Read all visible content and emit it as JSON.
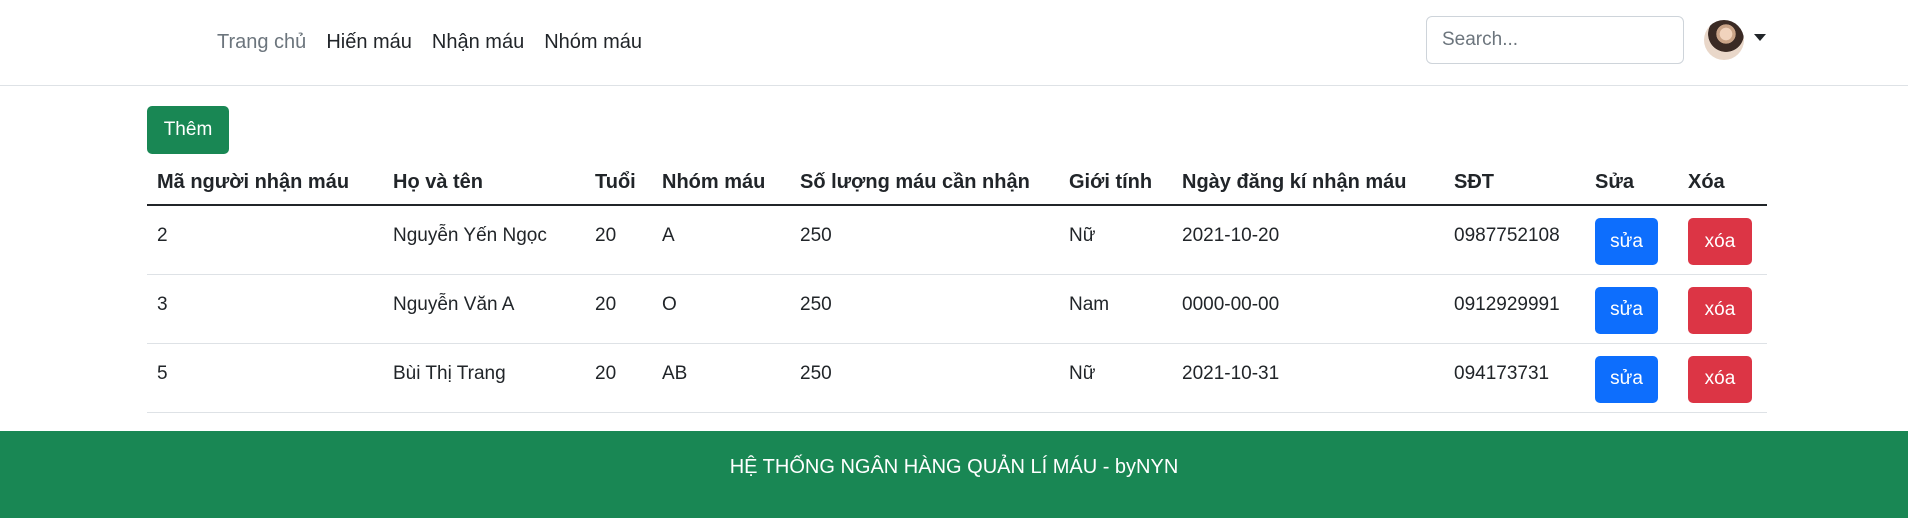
{
  "nav": {
    "links": [
      "Trang chủ",
      "Hiến máu",
      "Nhận máu",
      "Nhóm máu"
    ]
  },
  "search": {
    "placeholder": "Search..."
  },
  "actions": {
    "add_label": "Thêm"
  },
  "table": {
    "headers": [
      "Mã người nhận máu",
      "Họ và tên",
      "Tuổi",
      "Nhóm máu",
      "Số lượng máu cần nhận",
      "Giới tính",
      "Ngày đăng kí nhận máu",
      "SĐT",
      "Sửa",
      "Xóa"
    ],
    "rows": [
      {
        "id": "2",
        "name": "Nguyễn Yến Ngọc",
        "age": "20",
        "blood": "A",
        "qty": "250",
        "gender": "Nữ",
        "date": "2021-10-20",
        "phone": "0987752108",
        "edit": "sửa",
        "del": "xóa"
      },
      {
        "id": "3",
        "name": "Nguyễn Văn A",
        "age": "20",
        "blood": "O",
        "qty": "250",
        "gender": "Nam",
        "date": "0000-00-00",
        "phone": "0912929991",
        "edit": "sửa",
        "del": "xóa"
      },
      {
        "id": "5",
        "name": "Bùi Thị Trang",
        "age": "20",
        "blood": "AB",
        "qty": "250",
        "gender": "Nữ",
        "date": "2021-10-31",
        "phone": "094173731",
        "edit": "sửa",
        "del": "xóa"
      }
    ]
  },
  "footer": {
    "text": "HỆ THỐNG NGÂN HÀNG QUẢN LÍ MÁU - byNYN"
  },
  "colors": {
    "primary": "#0d6efd",
    "success": "#198754",
    "danger": "#dc3545"
  }
}
